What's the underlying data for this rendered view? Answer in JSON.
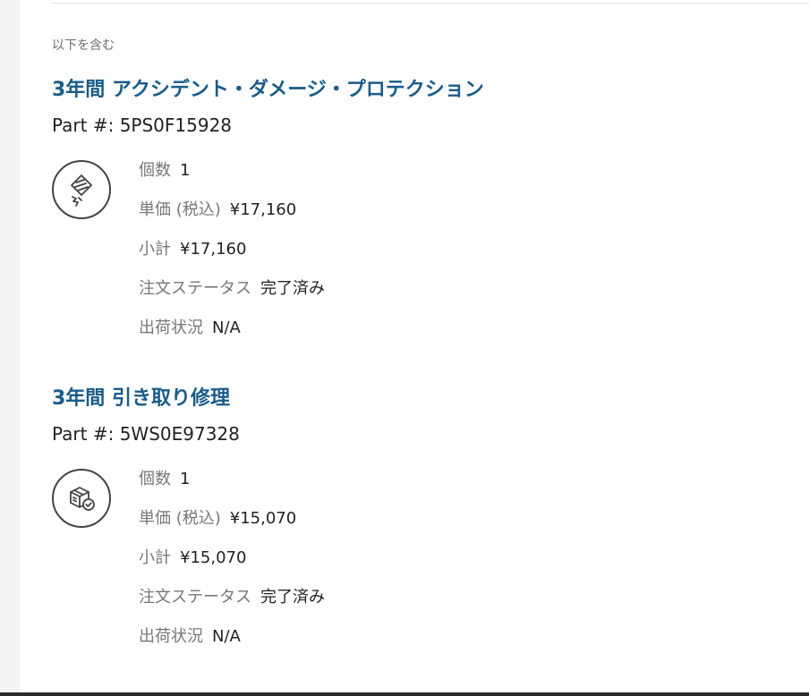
{
  "section": {
    "includes_label": "以下を含む"
  },
  "items": [
    {
      "title": "3年間 アクシデント・ダメージ・プロテクション",
      "part_number": "Part #: 5PS0F15928",
      "icon": "damage-protection-icon",
      "quantity_label": "個数",
      "quantity_value": "1",
      "unit_price_label": "単価 (税込)",
      "unit_price_value": "¥17,160",
      "subtotal_label": "小計",
      "subtotal_value": "¥17,160",
      "order_status_label": "注文ステータス",
      "order_status_value": "完了済み",
      "shipping_status_label": "出荷状況",
      "shipping_status_value": "N/A"
    },
    {
      "title": "3年間 引き取り修理",
      "part_number": "Part #: 5WS0E97328",
      "icon": "repair-pickup-icon",
      "quantity_label": "個数",
      "quantity_value": "1",
      "unit_price_label": "単価 (税込)",
      "unit_price_value": "¥15,070",
      "subtotal_label": "小計",
      "subtotal_value": "¥15,070",
      "order_status_label": "注文ステータス",
      "order_status_value": "完了済み",
      "shipping_status_label": "出荷状況",
      "shipping_status_value": "N/A"
    }
  ],
  "colors": {
    "title": "#1a5c8a",
    "label": "#777777",
    "value": "#222222"
  }
}
